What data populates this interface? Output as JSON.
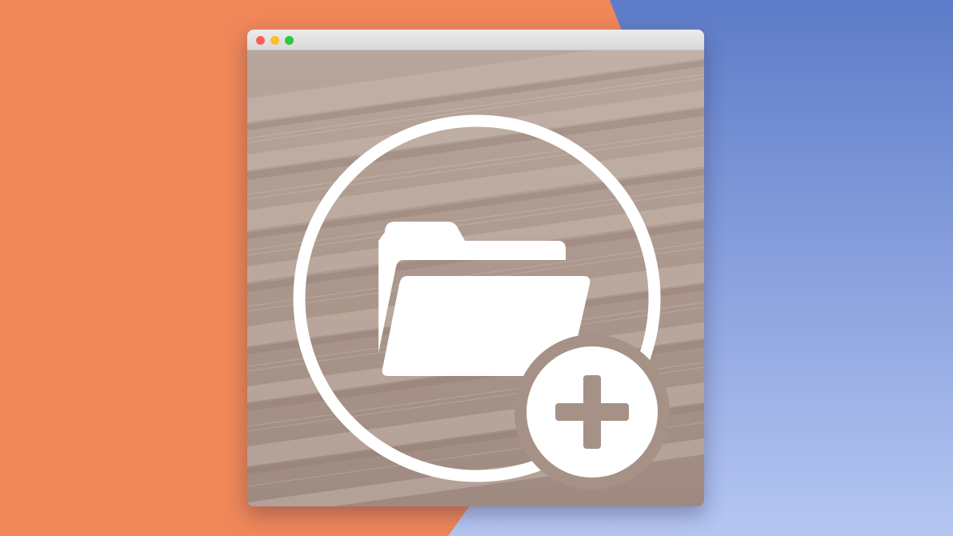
{
  "background": {
    "left_color": "#EF8759",
    "right_color_top": "#5D7BC8",
    "right_color_bottom": "#B5C6F2"
  },
  "window": {
    "titlebar_color": "#E3E3E3",
    "traffic_lights": {
      "close": "#FE5F57",
      "minimize": "#FEBC2E",
      "zoom": "#28C840"
    },
    "content": {
      "image_tint": "#A8958B",
      "icon": "add-folder-icon",
      "icon_color": "#FFFFFF"
    }
  }
}
